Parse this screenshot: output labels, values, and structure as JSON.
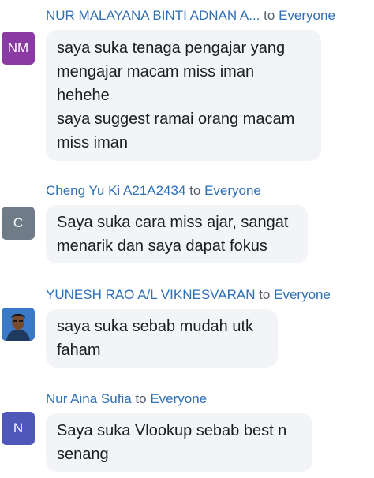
{
  "chat": {
    "messages": [
      {
        "sender": "NUR MALAYANA BINTI ADNAN A...",
        "to_word": "to",
        "audience": "Everyone",
        "avatar_initials": "NM",
        "avatar_color": "#8a3aa3",
        "lines": [
          "saya suka tenaga pengajar yang",
          "mengajar macam miss iman",
          "hehehe",
          "saya suggest ramai orang macam",
          "miss iman"
        ]
      },
      {
        "sender": "Cheng Yu Ki A21A2434",
        "to_word": "to",
        "audience": "Everyone",
        "avatar_initials": "C",
        "avatar_color": "#6f7c87",
        "lines": [
          "Saya suka cara miss ajar, sangat",
          "menarik dan saya dapat fokus"
        ]
      },
      {
        "sender": "YUNESH RAO A/L VIKNESVARAN",
        "to_word": "to",
        "audience": "Everyone",
        "avatar_type": "photo",
        "lines": [
          "saya suka sebab mudah utk",
          "faham"
        ]
      },
      {
        "sender": "Nur Aina Sufia",
        "to_word": "to",
        "audience": "Everyone",
        "avatar_initials": "N",
        "avatar_color": "#4f58b8",
        "lines": [
          "Saya suka Vlookup sebab best n",
          "senang"
        ]
      }
    ]
  },
  "colors": {
    "sender_blue": "#2f6fb6",
    "bubble_bg": "#f3f4f7",
    "text": "#1b1d22"
  }
}
